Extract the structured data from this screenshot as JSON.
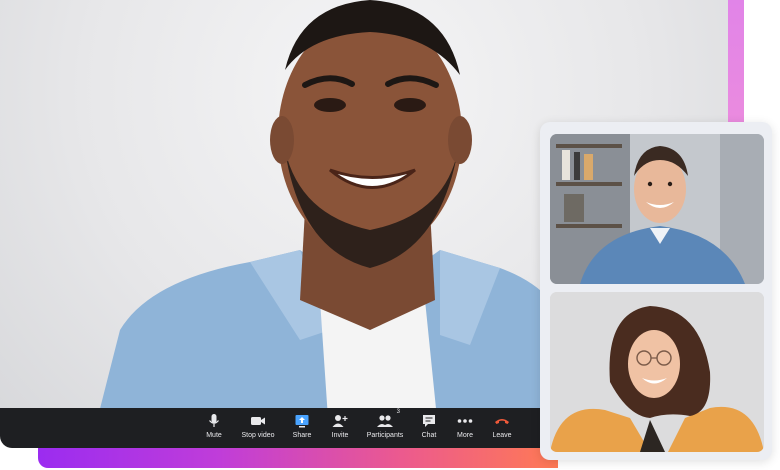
{
  "toolbar": {
    "controls": [
      {
        "label": "Mute",
        "icon": "microphone-icon"
      },
      {
        "label": "Stop video",
        "icon": "video-camera-icon"
      },
      {
        "label": "Share",
        "icon": "share-screen-icon"
      },
      {
        "label": "Invite",
        "icon": "invite-user-icon"
      },
      {
        "label": "Participants",
        "icon": "participants-icon",
        "badge": "3"
      },
      {
        "label": "Chat",
        "icon": "chat-icon"
      },
      {
        "label": "More",
        "icon": "more-dots-icon"
      },
      {
        "label": "Leave",
        "icon": "leave-phone-icon"
      }
    ]
  },
  "colors": {
    "toolbar_bg": "#1e1f22",
    "share_accent": "#4aa3ff",
    "leave_red": "#f05a3a",
    "stripe_purple": "#9b2cf0",
    "stripe_pink": "#ec5a8e",
    "stripe_orange": "#ff7a54"
  }
}
